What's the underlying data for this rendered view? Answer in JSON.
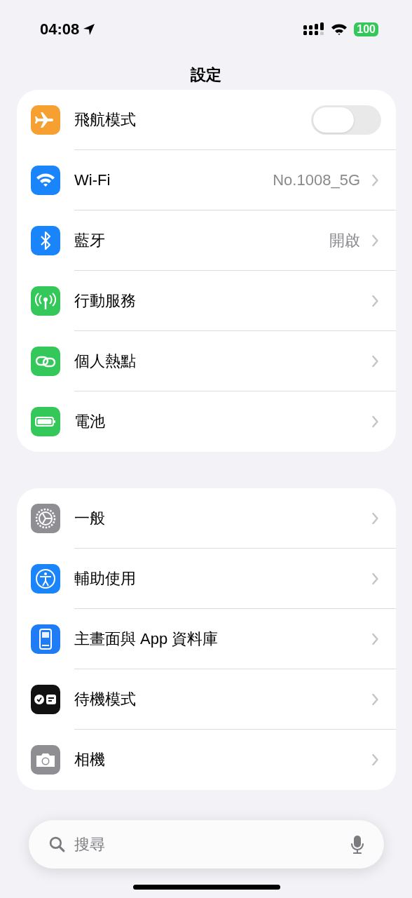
{
  "status_bar": {
    "time": "04:08",
    "battery": "100"
  },
  "title": "設定",
  "groups": [
    {
      "rows": [
        {
          "kind": "toggle",
          "label": "飛航模式",
          "on": false
        },
        {
          "kind": "link",
          "label": "Wi-Fi",
          "value": "No.1008_5G"
        },
        {
          "kind": "link",
          "label": "藍牙",
          "value": "開啟"
        },
        {
          "kind": "link",
          "label": "行動服務"
        },
        {
          "kind": "link",
          "label": "個人熱點"
        },
        {
          "kind": "link",
          "label": "電池"
        }
      ]
    },
    {
      "rows": [
        {
          "kind": "link",
          "label": "一般"
        },
        {
          "kind": "link",
          "label": "輔助使用"
        },
        {
          "kind": "link",
          "label": "主畫面與 App 資料庫"
        },
        {
          "kind": "link",
          "label": "待機模式"
        },
        {
          "kind": "link",
          "label": "相機"
        }
      ]
    }
  ],
  "search": {
    "placeholder": "搜尋"
  }
}
